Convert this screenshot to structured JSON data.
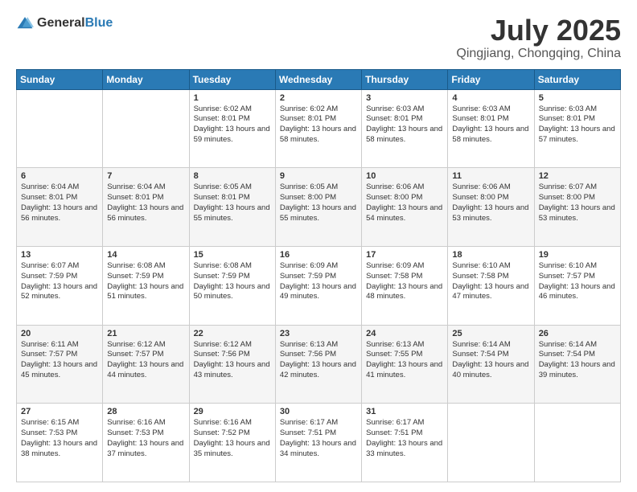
{
  "header": {
    "logo_general": "General",
    "logo_blue": "Blue",
    "title": "July 2025",
    "location": "Qingjiang, Chongqing, China"
  },
  "weekdays": [
    "Sunday",
    "Monday",
    "Tuesday",
    "Wednesday",
    "Thursday",
    "Friday",
    "Saturday"
  ],
  "weeks": [
    [
      {
        "day": "",
        "info": ""
      },
      {
        "day": "",
        "info": ""
      },
      {
        "day": "1",
        "info": "Sunrise: 6:02 AM\nSunset: 8:01 PM\nDaylight: 13 hours and 59 minutes."
      },
      {
        "day": "2",
        "info": "Sunrise: 6:02 AM\nSunset: 8:01 PM\nDaylight: 13 hours and 58 minutes."
      },
      {
        "day": "3",
        "info": "Sunrise: 6:03 AM\nSunset: 8:01 PM\nDaylight: 13 hours and 58 minutes."
      },
      {
        "day": "4",
        "info": "Sunrise: 6:03 AM\nSunset: 8:01 PM\nDaylight: 13 hours and 58 minutes."
      },
      {
        "day": "5",
        "info": "Sunrise: 6:03 AM\nSunset: 8:01 PM\nDaylight: 13 hours and 57 minutes."
      }
    ],
    [
      {
        "day": "6",
        "info": "Sunrise: 6:04 AM\nSunset: 8:01 PM\nDaylight: 13 hours and 56 minutes."
      },
      {
        "day": "7",
        "info": "Sunrise: 6:04 AM\nSunset: 8:01 PM\nDaylight: 13 hours and 56 minutes."
      },
      {
        "day": "8",
        "info": "Sunrise: 6:05 AM\nSunset: 8:01 PM\nDaylight: 13 hours and 55 minutes."
      },
      {
        "day": "9",
        "info": "Sunrise: 6:05 AM\nSunset: 8:00 PM\nDaylight: 13 hours and 55 minutes."
      },
      {
        "day": "10",
        "info": "Sunrise: 6:06 AM\nSunset: 8:00 PM\nDaylight: 13 hours and 54 minutes."
      },
      {
        "day": "11",
        "info": "Sunrise: 6:06 AM\nSunset: 8:00 PM\nDaylight: 13 hours and 53 minutes."
      },
      {
        "day": "12",
        "info": "Sunrise: 6:07 AM\nSunset: 8:00 PM\nDaylight: 13 hours and 53 minutes."
      }
    ],
    [
      {
        "day": "13",
        "info": "Sunrise: 6:07 AM\nSunset: 7:59 PM\nDaylight: 13 hours and 52 minutes."
      },
      {
        "day": "14",
        "info": "Sunrise: 6:08 AM\nSunset: 7:59 PM\nDaylight: 13 hours and 51 minutes."
      },
      {
        "day": "15",
        "info": "Sunrise: 6:08 AM\nSunset: 7:59 PM\nDaylight: 13 hours and 50 minutes."
      },
      {
        "day": "16",
        "info": "Sunrise: 6:09 AM\nSunset: 7:59 PM\nDaylight: 13 hours and 49 minutes."
      },
      {
        "day": "17",
        "info": "Sunrise: 6:09 AM\nSunset: 7:58 PM\nDaylight: 13 hours and 48 minutes."
      },
      {
        "day": "18",
        "info": "Sunrise: 6:10 AM\nSunset: 7:58 PM\nDaylight: 13 hours and 47 minutes."
      },
      {
        "day": "19",
        "info": "Sunrise: 6:10 AM\nSunset: 7:57 PM\nDaylight: 13 hours and 46 minutes."
      }
    ],
    [
      {
        "day": "20",
        "info": "Sunrise: 6:11 AM\nSunset: 7:57 PM\nDaylight: 13 hours and 45 minutes."
      },
      {
        "day": "21",
        "info": "Sunrise: 6:12 AM\nSunset: 7:57 PM\nDaylight: 13 hours and 44 minutes."
      },
      {
        "day": "22",
        "info": "Sunrise: 6:12 AM\nSunset: 7:56 PM\nDaylight: 13 hours and 43 minutes."
      },
      {
        "day": "23",
        "info": "Sunrise: 6:13 AM\nSunset: 7:56 PM\nDaylight: 13 hours and 42 minutes."
      },
      {
        "day": "24",
        "info": "Sunrise: 6:13 AM\nSunset: 7:55 PM\nDaylight: 13 hours and 41 minutes."
      },
      {
        "day": "25",
        "info": "Sunrise: 6:14 AM\nSunset: 7:54 PM\nDaylight: 13 hours and 40 minutes."
      },
      {
        "day": "26",
        "info": "Sunrise: 6:14 AM\nSunset: 7:54 PM\nDaylight: 13 hours and 39 minutes."
      }
    ],
    [
      {
        "day": "27",
        "info": "Sunrise: 6:15 AM\nSunset: 7:53 PM\nDaylight: 13 hours and 38 minutes."
      },
      {
        "day": "28",
        "info": "Sunrise: 6:16 AM\nSunset: 7:53 PM\nDaylight: 13 hours and 37 minutes."
      },
      {
        "day": "29",
        "info": "Sunrise: 6:16 AM\nSunset: 7:52 PM\nDaylight: 13 hours and 35 minutes."
      },
      {
        "day": "30",
        "info": "Sunrise: 6:17 AM\nSunset: 7:51 PM\nDaylight: 13 hours and 34 minutes."
      },
      {
        "day": "31",
        "info": "Sunrise: 6:17 AM\nSunset: 7:51 PM\nDaylight: 13 hours and 33 minutes."
      },
      {
        "day": "",
        "info": ""
      },
      {
        "day": "",
        "info": ""
      }
    ]
  ]
}
